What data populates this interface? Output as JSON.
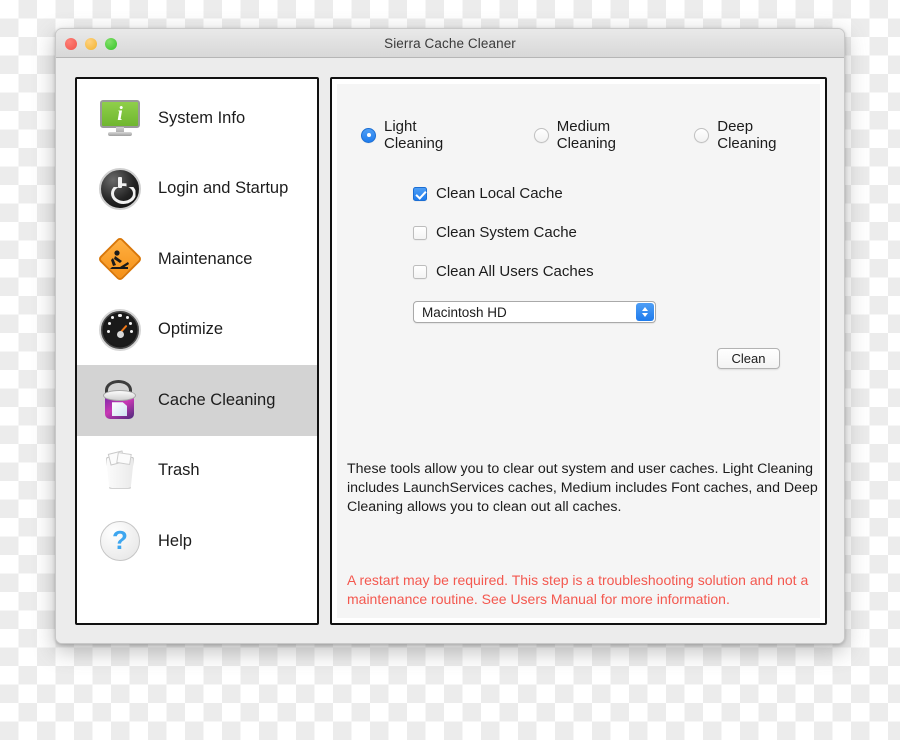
{
  "window": {
    "title": "Sierra Cache Cleaner",
    "traffic_lights": [
      {
        "name": "close",
        "color": "#f0534b"
      },
      {
        "name": "minimize",
        "color": "#f2b32e"
      },
      {
        "name": "zoom",
        "color": "#34c326"
      }
    ]
  },
  "sidebar": {
    "items": [
      {
        "label": "System Info",
        "icon": "monitor-info-icon",
        "selected": false
      },
      {
        "label": "Login and Startup",
        "icon": "power-button-icon",
        "selected": false
      },
      {
        "label": "Maintenance",
        "icon": "construction-sign-icon",
        "selected": false
      },
      {
        "label": "Optimize",
        "icon": "speedometer-icon",
        "selected": false
      },
      {
        "label": "Cache Cleaning",
        "icon": "cleaning-bucket-icon",
        "selected": true
      },
      {
        "label": "Trash",
        "icon": "trash-can-icon",
        "selected": false
      },
      {
        "label": "Help",
        "icon": "question-mark-icon",
        "selected": false
      }
    ]
  },
  "main": {
    "cleaning_levels": [
      {
        "label": "Light Cleaning",
        "selected": true
      },
      {
        "label": "Medium Cleaning",
        "selected": false
      },
      {
        "label": "Deep Cleaning",
        "selected": false
      }
    ],
    "cache_options": [
      {
        "label": "Clean Local Cache",
        "checked": true
      },
      {
        "label": "Clean System Cache",
        "checked": false
      },
      {
        "label": "Clean All Users Caches",
        "checked": false
      }
    ],
    "volume_select": {
      "value": "Macintosh HD",
      "stepper_icon": "up-down-chevron-icon"
    },
    "clean_button": "Clean",
    "description": "These tools allow you to clear out system and user caches.  Light Cleaning includes LaunchServices caches, Medium includes Font caches, and Deep Cleaning allows you to clean out all caches.",
    "warning": "A restart may be required.  This step is a troubleshooting solution and not a maintenance routine.  See Users Manual for more information.",
    "warning_color": "#f4584f",
    "accent_color": "#1f7ced"
  }
}
